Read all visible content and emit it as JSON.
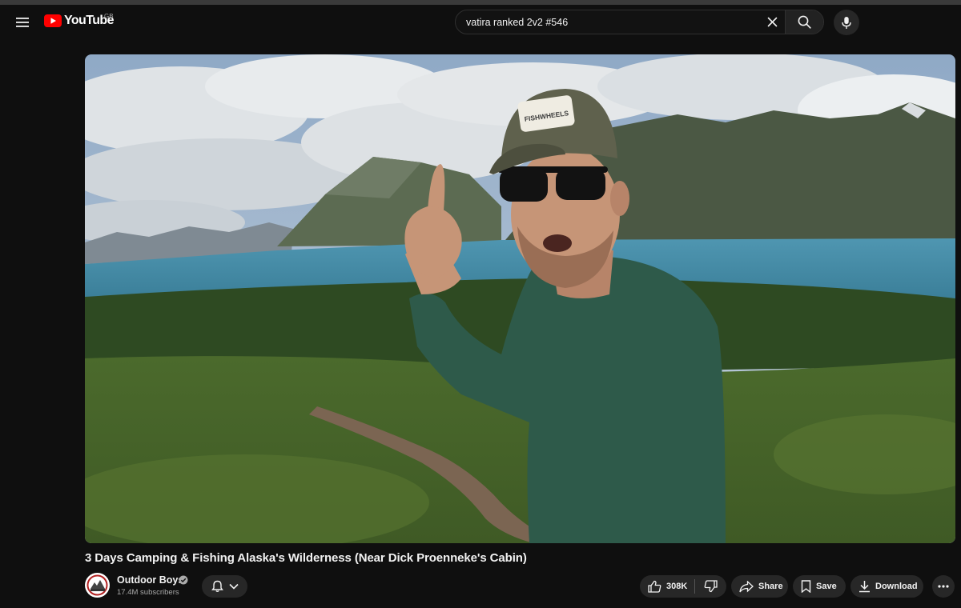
{
  "header": {
    "logo_text": "YouTube",
    "region": "GB",
    "search_value": "vatira ranked 2v2 #546"
  },
  "video": {
    "title": "3 Days Camping & Fishing Alaska's Wilderness (Near Dick Proenneke's Cabin)",
    "cap_text": "FISHWHEELS"
  },
  "channel": {
    "name": "Outdoor Boys",
    "subscribers": "17.4M subscribers"
  },
  "actions": {
    "likes": "308K",
    "share": "Share",
    "save": "Save",
    "download": "Download"
  },
  "colors": {
    "background": "#0f0f0f",
    "brand_red": "#ff0000",
    "pill_bg": "#272727"
  },
  "icons": [
    "menu-icon",
    "youtube-logo-icon",
    "close-icon",
    "search-icon",
    "mic-icon",
    "verified-icon",
    "bell-icon",
    "chevron-down-icon",
    "thumbs-up-icon",
    "thumbs-down-icon",
    "share-icon",
    "bookmark-icon",
    "download-icon",
    "more-icon"
  ]
}
